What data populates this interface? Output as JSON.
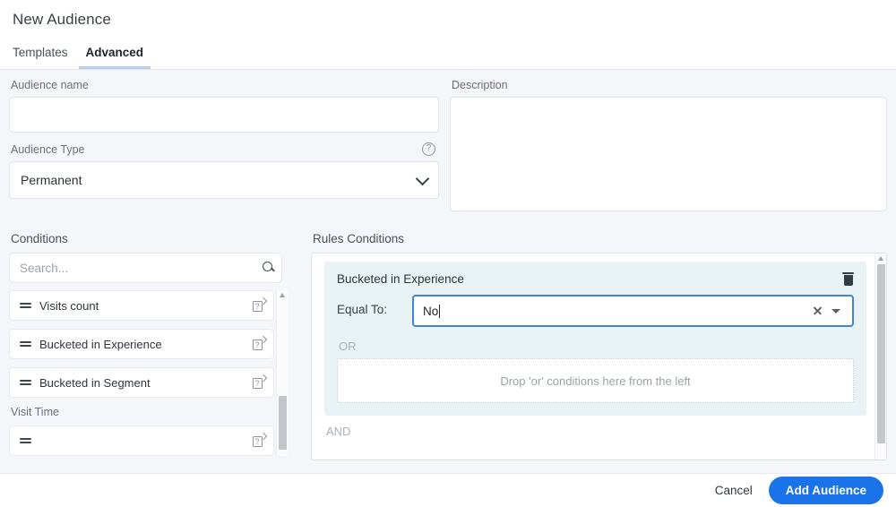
{
  "header": {
    "title": "New Audience",
    "tabs": [
      {
        "label": "Templates",
        "active": false
      },
      {
        "label": "Advanced",
        "active": true
      }
    ]
  },
  "form": {
    "audience_name": {
      "label": "Audience name",
      "value": "",
      "placeholder": ""
    },
    "description": {
      "label": "Description",
      "value": "",
      "placeholder": ""
    },
    "audience_type": {
      "label": "Audience Type",
      "value": "Permanent",
      "help_icon": "help-circle-icon",
      "chevron_icon": "chevron-down-icon"
    }
  },
  "conditions_panel": {
    "heading": "Conditions",
    "search": {
      "placeholder": "Search...",
      "value": "",
      "icon": "search-icon"
    },
    "items": [
      {
        "label": "Visits count",
        "drag_icon": "drag-handle-icon",
        "info_icon": "help-popout-icon"
      },
      {
        "label": "Bucketed in Experience",
        "drag_icon": "drag-handle-icon",
        "info_icon": "help-popout-icon"
      },
      {
        "label": "Bucketed in Segment",
        "drag_icon": "drag-handle-icon",
        "info_icon": "help-popout-icon"
      }
    ],
    "group_heading": "Visit Time",
    "scrollbar": {
      "up_arrow_icon": "scroll-up-arrow-icon"
    }
  },
  "rules_panel": {
    "heading": "Rules Conditions",
    "card": {
      "title": "Bucketed in Experience",
      "delete_icon": "trash-icon",
      "operator_label": "Equal To:",
      "value": "No",
      "clear_icon": "clear-x-icon",
      "dropdown_icon": "caret-down-icon",
      "or_label": "OR",
      "or_dropzone_text": "Drop 'or' conditions here from the left",
      "and_label": "AND"
    },
    "scrollbar": {
      "up_arrow_icon": "scroll-up-arrow-icon"
    }
  },
  "footer": {
    "cancel_label": "Cancel",
    "submit_label": "Add Audience"
  },
  "colors": {
    "accent": "#1a73e8",
    "tab_underline": "#b9cfee",
    "page_bg": "#f4f6f9",
    "card_bg": "#e9f2f5",
    "focus_border": "#4285d6"
  }
}
